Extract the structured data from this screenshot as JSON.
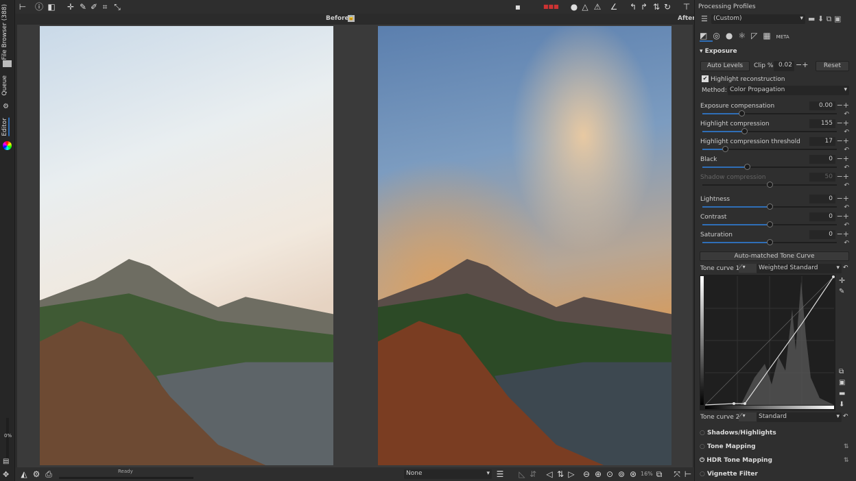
{
  "sidebar": {
    "tabs": [
      {
        "label": "File Browser (388)"
      },
      {
        "label": "Queue"
      },
      {
        "label": "Editor"
      }
    ],
    "progress": "0%"
  },
  "viewer": {
    "before_label": "Before",
    "after_label": "After"
  },
  "statusbar": {
    "status": "Ready",
    "profile_select": "None",
    "zoom": "16%"
  },
  "profiles": {
    "title": "Processing Profiles",
    "selected": "(Custom)"
  },
  "tool_tabs": [
    "exposure-icon",
    "detail-icon",
    "color-icon",
    "advanced-icon",
    "transform-icon",
    "raw-icon",
    "META"
  ],
  "exposure": {
    "title": "Exposure",
    "auto_levels": "Auto Levels",
    "clip_label": "Clip %",
    "clip_value": "0.02",
    "reset": "Reset",
    "highlight_reconstruction": "Highlight reconstruction",
    "method_label": "Method:",
    "method_value": "Color Propagation",
    "sliders": [
      {
        "label": "Exposure compensation",
        "value": "0.00",
        "position": 0.29,
        "enabled": true
      },
      {
        "label": "Highlight compression",
        "value": "155",
        "position": 0.31,
        "enabled": true
      },
      {
        "label": "Highlight compression threshold",
        "value": "17",
        "position": 0.17,
        "enabled": true
      },
      {
        "label": "Black",
        "value": "0",
        "position": 0.33,
        "enabled": true
      },
      {
        "label": "Shadow compression",
        "value": "50",
        "position": 0.5,
        "enabled": false
      },
      {
        "label": "Lightness",
        "value": "0",
        "position": 0.5,
        "enabled": true
      },
      {
        "label": "Contrast",
        "value": "0",
        "position": 0.5,
        "enabled": true
      },
      {
        "label": "Saturation",
        "value": "0",
        "position": 0.5,
        "enabled": true
      }
    ],
    "auto_tone": "Auto-matched Tone Curve",
    "tc1_label": "Tone curve 1:",
    "tc1_value": "Weighted Standard",
    "tc2_label": "Tone curve 2:",
    "tc2_value": "Standard"
  },
  "sections": [
    "Shadows/Highlights",
    "Tone Mapping",
    "HDR Tone Mapping",
    "Vignette Filter"
  ],
  "colors": {
    "accent": "#2f6fb8",
    "bg": "#2b2b2b"
  }
}
